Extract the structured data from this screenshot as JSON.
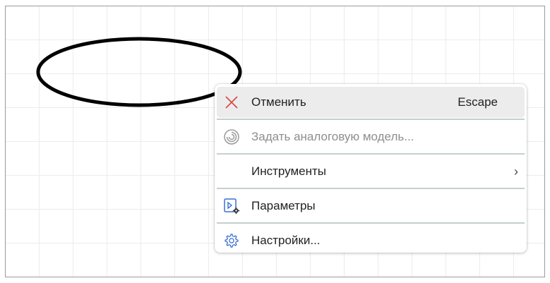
{
  "menu": {
    "items": [
      {
        "label": "Отменить",
        "shortcut": "Escape",
        "icon": "close-icon",
        "state": "hovered"
      },
      {
        "label": "Задать аналоговую модель...",
        "icon": "spiral-icon",
        "state": "disabled"
      },
      {
        "label": "Инструменты",
        "submenu_indicator": "›"
      },
      {
        "label": "Параметры",
        "icon": "parameters-icon"
      },
      {
        "label": "Настройки...",
        "icon": "gear-icon"
      }
    ]
  },
  "colors": {
    "cancel_icon": "#d9463f",
    "accent_icon": "#3a6fd3",
    "disabled_icon": "#9a9a9a",
    "hover_background": "#ececec",
    "separator": "#c5d0cc"
  }
}
